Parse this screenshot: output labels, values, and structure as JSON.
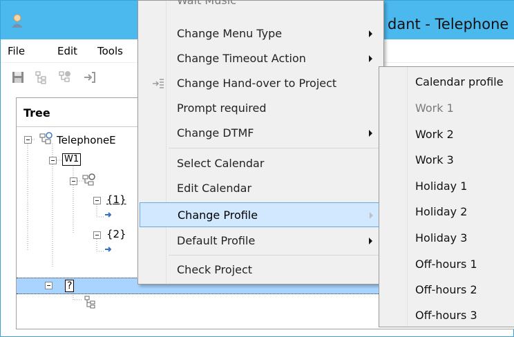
{
  "window": {
    "title": "dant - Telephone"
  },
  "menubar": {
    "items": [
      "File",
      "Edit",
      "Tools"
    ]
  },
  "toolbar": {
    "buttons": [
      "save-icon",
      "tree-icon",
      "tree-add-icon",
      "login-icon"
    ]
  },
  "tree": {
    "header": "Tree",
    "root_label": "TelephoneE",
    "node_w1": "W1",
    "node_1": "{1}",
    "node_2": "{2}",
    "node_unknown": "?"
  },
  "context_menu": {
    "cut_top": "Wait Music",
    "items": [
      {
        "label": "Change Menu Type",
        "submenu": true,
        "disabled": false
      },
      {
        "label": "Change Timeout Action",
        "submenu": true,
        "disabled": false
      },
      {
        "label": "Change Hand-over to Project",
        "submenu": false,
        "disabled": false,
        "icon": "handover-icon"
      },
      {
        "label": "Prompt required",
        "submenu": false,
        "disabled": false
      },
      {
        "label": "Change DTMF",
        "submenu": true,
        "disabled": false
      },
      {
        "label": "Select Calendar",
        "submenu": false,
        "disabled": false
      },
      {
        "label": "Edit Calendar",
        "submenu": false,
        "disabled": false
      },
      {
        "label": "Change Profile",
        "submenu": true,
        "disabled": false,
        "highlighted": true
      },
      {
        "label": "Default Profile",
        "submenu": true,
        "disabled": false
      },
      {
        "label": "Check Project",
        "submenu": false,
        "disabled": false
      }
    ]
  },
  "profile_submenu": {
    "items": [
      {
        "label": "Calendar profile",
        "disabled": false
      },
      {
        "label": "Work 1",
        "disabled": true
      },
      {
        "label": "Work 2",
        "disabled": false
      },
      {
        "label": "Work 3",
        "disabled": false
      },
      {
        "label": "Holiday 1",
        "disabled": false
      },
      {
        "label": "Holiday 2",
        "disabled": false
      },
      {
        "label": "Holiday 3",
        "disabled": false
      },
      {
        "label": "Off-hours 1",
        "disabled": false
      },
      {
        "label": "Off-hours 2",
        "disabled": false
      },
      {
        "label": "Off-hours 3",
        "disabled": false
      }
    ]
  },
  "colors": {
    "titlebar": "#4cb9ee",
    "menu_bg": "#f0f0f0",
    "highlight": "#d1e8ff",
    "selection": "#a8d4ff"
  }
}
